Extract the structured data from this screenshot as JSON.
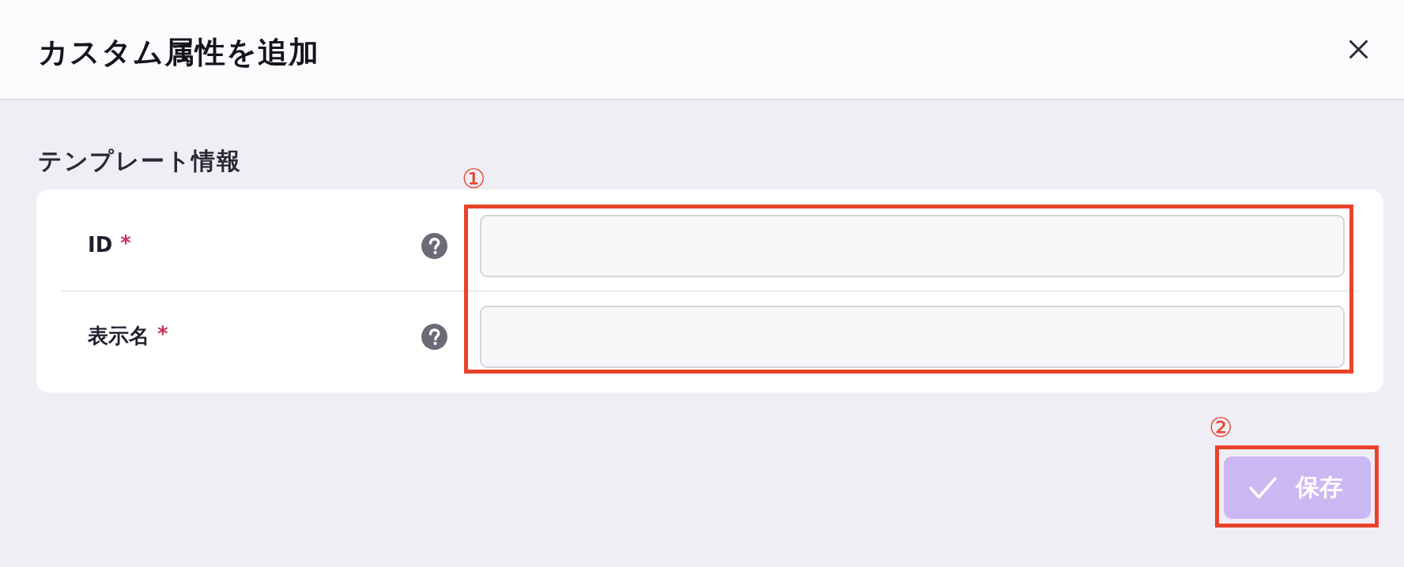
{
  "dialog": {
    "title": "カスタム属性を追加"
  },
  "section": {
    "title": "テンプレート情報",
    "annotation": "①",
    "fields": [
      {
        "label": "ID",
        "required_mark": "*"
      },
      {
        "label": "表示名",
        "required_mark": "*"
      }
    ]
  },
  "save_button": {
    "label": "保存",
    "disabled": true,
    "annotation": "②"
  }
}
